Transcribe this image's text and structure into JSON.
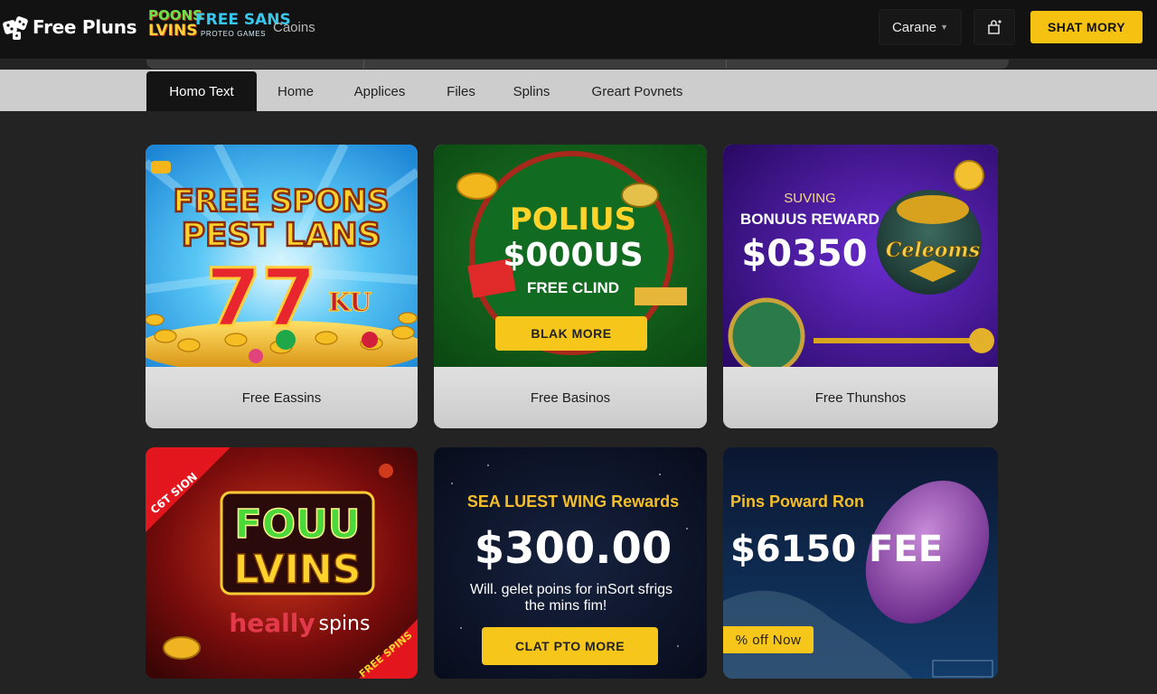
{
  "header": {
    "brand_name": "Free Pluns",
    "partner_logo": [
      "POONS",
      "LVINS",
      "FREE SANS",
      "PROTEO GAMES",
      "Caoins"
    ],
    "currency_label": "Carane",
    "cta_label": "SHAT MORY"
  },
  "nav": {
    "tabs": [
      {
        "label": "Homo Text",
        "active": true
      },
      {
        "label": "Home",
        "active": false
      },
      {
        "label": "Applices",
        "active": false
      },
      {
        "label": "Files",
        "active": false
      },
      {
        "label": "Splins",
        "active": false
      },
      {
        "label": "Greart Povnets",
        "active": false
      }
    ]
  },
  "cards": [
    {
      "caption": "Free Eassins",
      "art_text": [
        "FREE SPONS",
        "PEST LANS",
        "77",
        "KU"
      ]
    },
    {
      "caption": "Free Basinos",
      "art_text": [
        "POLIUS",
        "$000US",
        "FREE CLIND"
      ],
      "button_label": "BLAK MORE"
    },
    {
      "caption": "Free Thunshos",
      "art_text": [
        "SUVING",
        "BONUUS REWARD",
        "$0350",
        "Celeoms"
      ]
    },
    {
      "art_text": [
        "FOUU",
        "LVINS",
        "heally",
        "spins",
        "C6T SION",
        "FREE SPINS"
      ]
    },
    {
      "art_text": [
        "SEA LUEST WING Rewards",
        "$300.00",
        "Will. gelet poins for inSort sfrigs",
        "the mins fim!"
      ],
      "button_label": "CLAT PTO MORE"
    },
    {
      "art_text": [
        "Pins Poward Ron",
        "$6150 FEE"
      ],
      "button_label": "% off Now"
    }
  ],
  "colors": {
    "header_bg": "#121212",
    "accent_yellow": "#f5c211",
    "page_bg": "#232323",
    "nav_bg": "#cdcdcd"
  }
}
